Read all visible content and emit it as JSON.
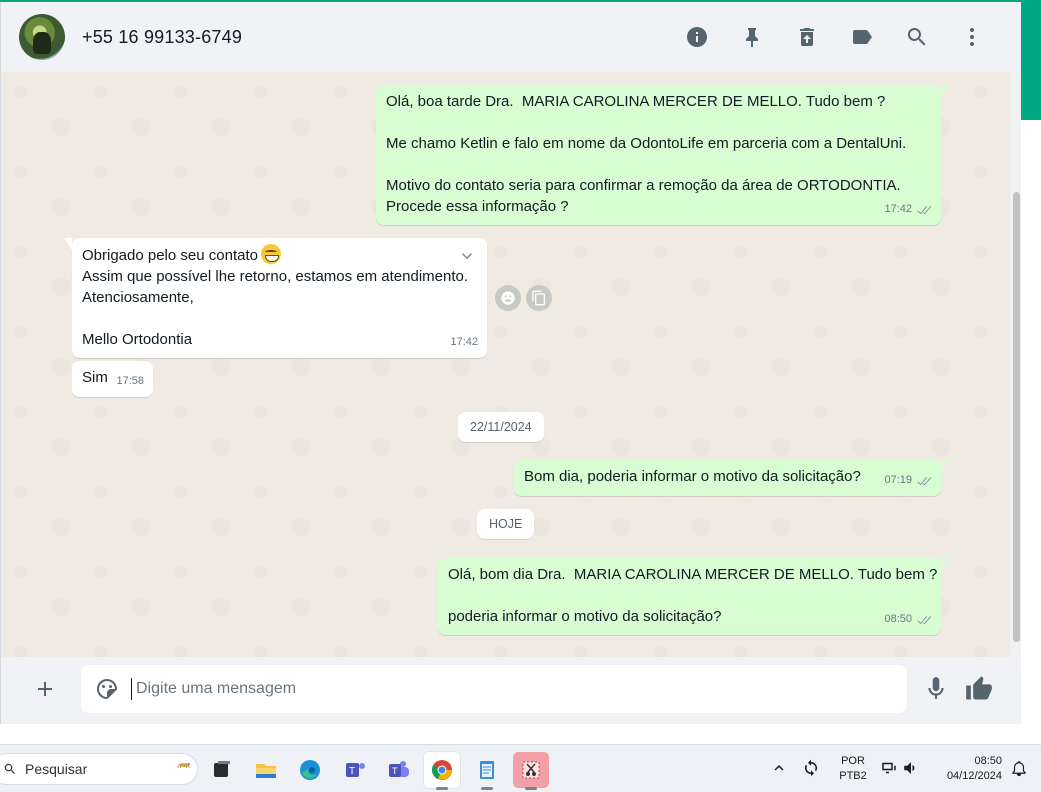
{
  "header": {
    "contact": "+55 16 99133-6749",
    "icons": [
      "info-icon",
      "pin-icon",
      "delete-icon",
      "label-icon",
      "search-icon",
      "menu-icon"
    ]
  },
  "messages": {
    "m1": {
      "lines": [
        "Olá, boa tarde Dra.  MARIA CAROLINA MERCER DE MELLO. Tudo bem ?",
        "",
        "Me chamo Ketlin e falo em nome da OdontoLife em parceria com a DentalUni.",
        "",
        "Motivo do contato seria para confirmar a remoção da área de ORTODONTIA.",
        "Procede essa informação ?"
      ],
      "time": "17:42"
    },
    "m2": {
      "lines": [
        "Obrigado pelo seu contato",
        "Assim que possível lhe retorno, estamos em atendimento.",
        "Atenciosamente,",
        "",
        "Mello Ortodontia"
      ],
      "time": "17:42"
    },
    "m3": {
      "text": "Sim",
      "time": "17:58"
    },
    "date1": "22/11/2024",
    "m4": {
      "text": "Bom dia, poderia informar o motivo da solicitação?",
      "time": "07:19"
    },
    "date2": "HOJE",
    "m5": {
      "lines": [
        "Olá, bom dia Dra.  MARIA CAROLINA MERCER DE MELLO. Tudo bem ?",
        "",
        "poderia informar o motivo da solicitação?"
      ],
      "time": "08:50"
    }
  },
  "composer": {
    "placeholder": "Digite uma mensagem"
  },
  "taskbar": {
    "search_label": "Pesquisar",
    "lang_top": "POR",
    "lang_bottom": "PTB2",
    "time": "08:50",
    "date": "04/12/2024"
  },
  "colors": {
    "outgoing_bubble": "#d9fdd3",
    "incoming_bubble": "#ffffff",
    "chat_background": "#efeae2",
    "accent": "#00a884"
  }
}
